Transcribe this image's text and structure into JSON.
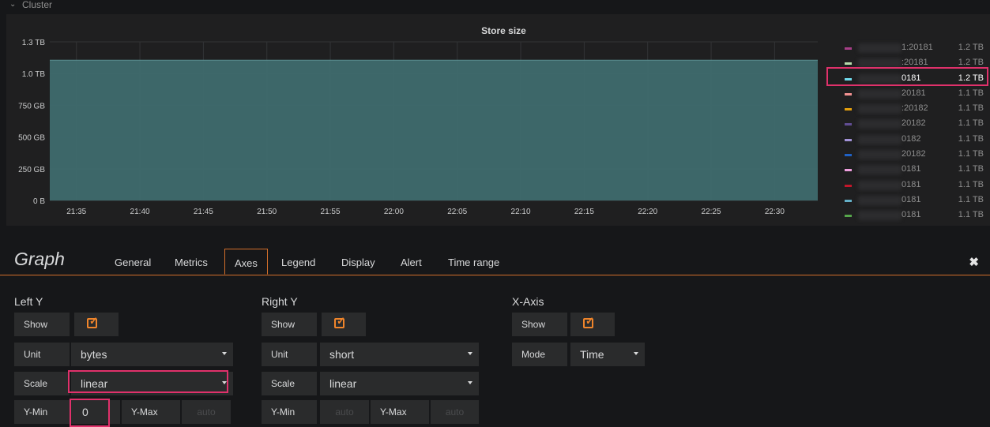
{
  "row": {
    "title": "Cluster"
  },
  "panel": {
    "title": "Store size",
    "legend": [
      {
        "name": "1:20181",
        "value": "1.2 TB",
        "color": "#a73f88"
      },
      {
        "name": ":20181",
        "value": "1.2 TB",
        "color": "#b7dbab"
      },
      {
        "name": "0181",
        "value": "1.2 TB",
        "color": "#70dbed",
        "active": true
      },
      {
        "name": "20181",
        "value": "1.1 TB",
        "color": "#f29191"
      },
      {
        "name": ":20182",
        "value": "1.1 TB",
        "color": "#e5a00d"
      },
      {
        "name": "20182",
        "value": "1.1 TB",
        "color": "#614d93"
      },
      {
        "name": "0182",
        "value": "1.1 TB",
        "color": "#a393d8"
      },
      {
        "name": "20182",
        "value": "1.1 TB",
        "color": "#1f61c4"
      },
      {
        "name": "0181",
        "value": "1.1 TB",
        "color": "#f0a0e0"
      },
      {
        "name": "0181",
        "value": "1.1 TB",
        "color": "#c4162a"
      },
      {
        "name": "0181",
        "value": "1.1 TB",
        "color": "#64b0c8"
      },
      {
        "name": "0181",
        "value": "1.1 TB",
        "color": "#56a64b"
      }
    ]
  },
  "chart_data": {
    "type": "area",
    "title": "Store size",
    "x": [
      "21:35",
      "21:40",
      "21:45",
      "21:50",
      "21:55",
      "22:00",
      "22:05",
      "22:10",
      "22:15",
      "22:20",
      "22:25",
      "22:30"
    ],
    "y_ticks": [
      "0 B",
      "250 GB",
      "500 GB",
      "750 GB",
      "1.0 TB",
      "1.3 TB"
    ],
    "ylim": [
      0,
      1.3
    ],
    "fill_level_tb": 1.15,
    "fill_color": "#3f6b6e",
    "grid": true
  },
  "editor": {
    "title": "Graph",
    "tabs": [
      "General",
      "Metrics",
      "Axes",
      "Legend",
      "Display",
      "Alert",
      "Time range"
    ],
    "active_tab": "Axes",
    "close": "✖"
  },
  "axes": {
    "left": {
      "title": "Left Y",
      "show_label": "Show",
      "show": true,
      "unit_label": "Unit",
      "unit": "bytes",
      "scale_label": "Scale",
      "scale": "linear",
      "ymin_label": "Y-Min",
      "ymin": "0",
      "ymax_label": "Y-Max",
      "ymax_placeholder": "auto"
    },
    "right": {
      "title": "Right Y",
      "show_label": "Show",
      "show": true,
      "unit_label": "Unit",
      "unit": "short",
      "scale_label": "Scale",
      "scale": "linear",
      "ymin_label": "Y-Min",
      "ymin_placeholder": "auto",
      "ymax_label": "Y-Max",
      "ymax_placeholder": "auto"
    },
    "x": {
      "title": "X-Axis",
      "show_label": "Show",
      "show": true,
      "mode_label": "Mode",
      "mode": "Time"
    }
  }
}
